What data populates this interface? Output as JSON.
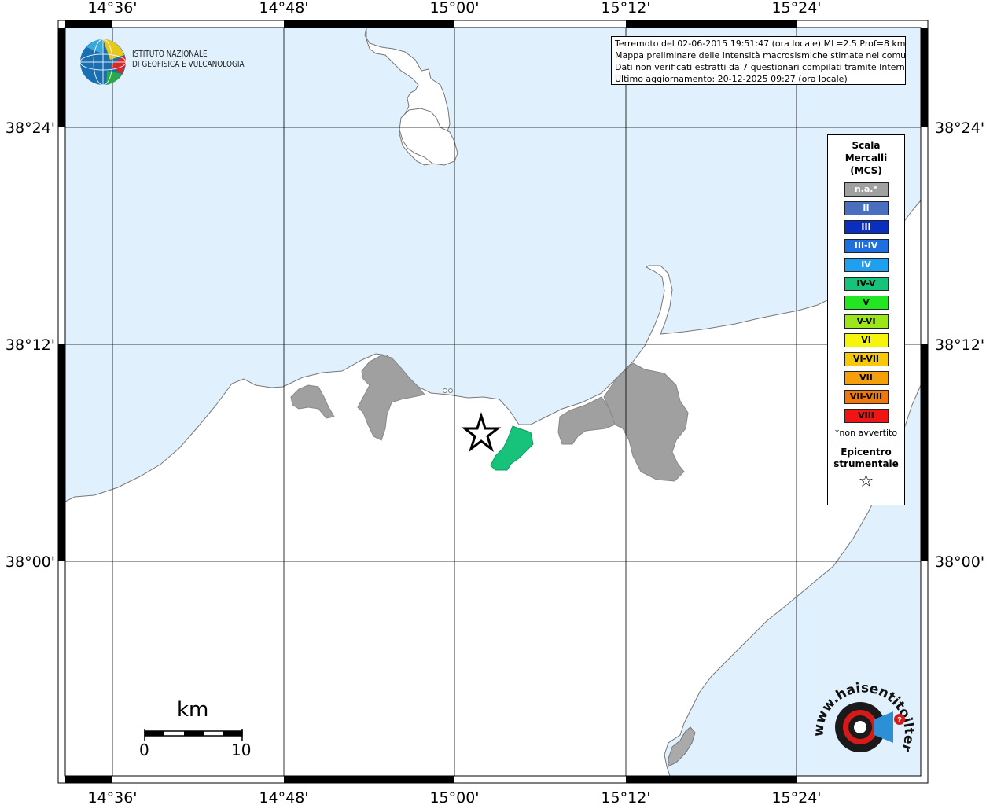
{
  "info": {
    "line1": "Terremoto del 02-06-2015 19:51:47 (ora locale) ML=2.5 Prof=8 km",
    "line2": "Mappa preliminare delle intensità macrosismiche stimate nei comuni",
    "line3": "Dati non verificati estratti da 7 questionari compilati tramite Internet.",
    "line4": "Ultimo aggiornamento: 20-12-2025 09:27 (ora locale)"
  },
  "logo": {
    "line1": "ISTITUTO NAZIONALE",
    "line2": "DI GEOFISICA E VULCANOLOGIA"
  },
  "axes": {
    "lon_labels": [
      "14°36'",
      "14°48'",
      "15°00'",
      "15°12'",
      "15°24'"
    ],
    "lat_labels": [
      "38°24'",
      "38°12'",
      "38°00'"
    ]
  },
  "legend": {
    "title1": "Scala",
    "title2": "Mercalli",
    "title3": "(MCS)",
    "items": [
      {
        "label": "n.a.*",
        "color": "#a0a0a0"
      },
      {
        "label": "II",
        "color": "#4a6fbf"
      },
      {
        "label": "III",
        "color": "#0a2fbf"
      },
      {
        "label": "III-IV",
        "color": "#1e6fe0"
      },
      {
        "label": "IV",
        "color": "#1e9ff0"
      },
      {
        "label": "IV-V",
        "color": "#17c27a"
      },
      {
        "label": "V",
        "color": "#22e622"
      },
      {
        "label": "V-VI",
        "color": "#9ae61a"
      },
      {
        "label": "VI",
        "color": "#f5f50a"
      },
      {
        "label": "VI-VII",
        "color": "#f5c80a"
      },
      {
        "label": "VII",
        "color": "#f5a00a"
      },
      {
        "label": "VII-VIII",
        "color": "#f0780a"
      },
      {
        "label": "VIII",
        "color": "#f01414"
      }
    ],
    "note": "*non avvertito",
    "epicenter1": "Epicentro",
    "epicenter2": "strumentale"
  },
  "scale": {
    "unit": "km",
    "min": "0",
    "max": "10"
  },
  "hst": {
    "text": "www.haisentitoilterremoto.it"
  },
  "colors": {
    "sea": "#e0f1fd",
    "land": "#ffffff",
    "na": "#a0a0a0",
    "iv_v": "#17c27a"
  }
}
